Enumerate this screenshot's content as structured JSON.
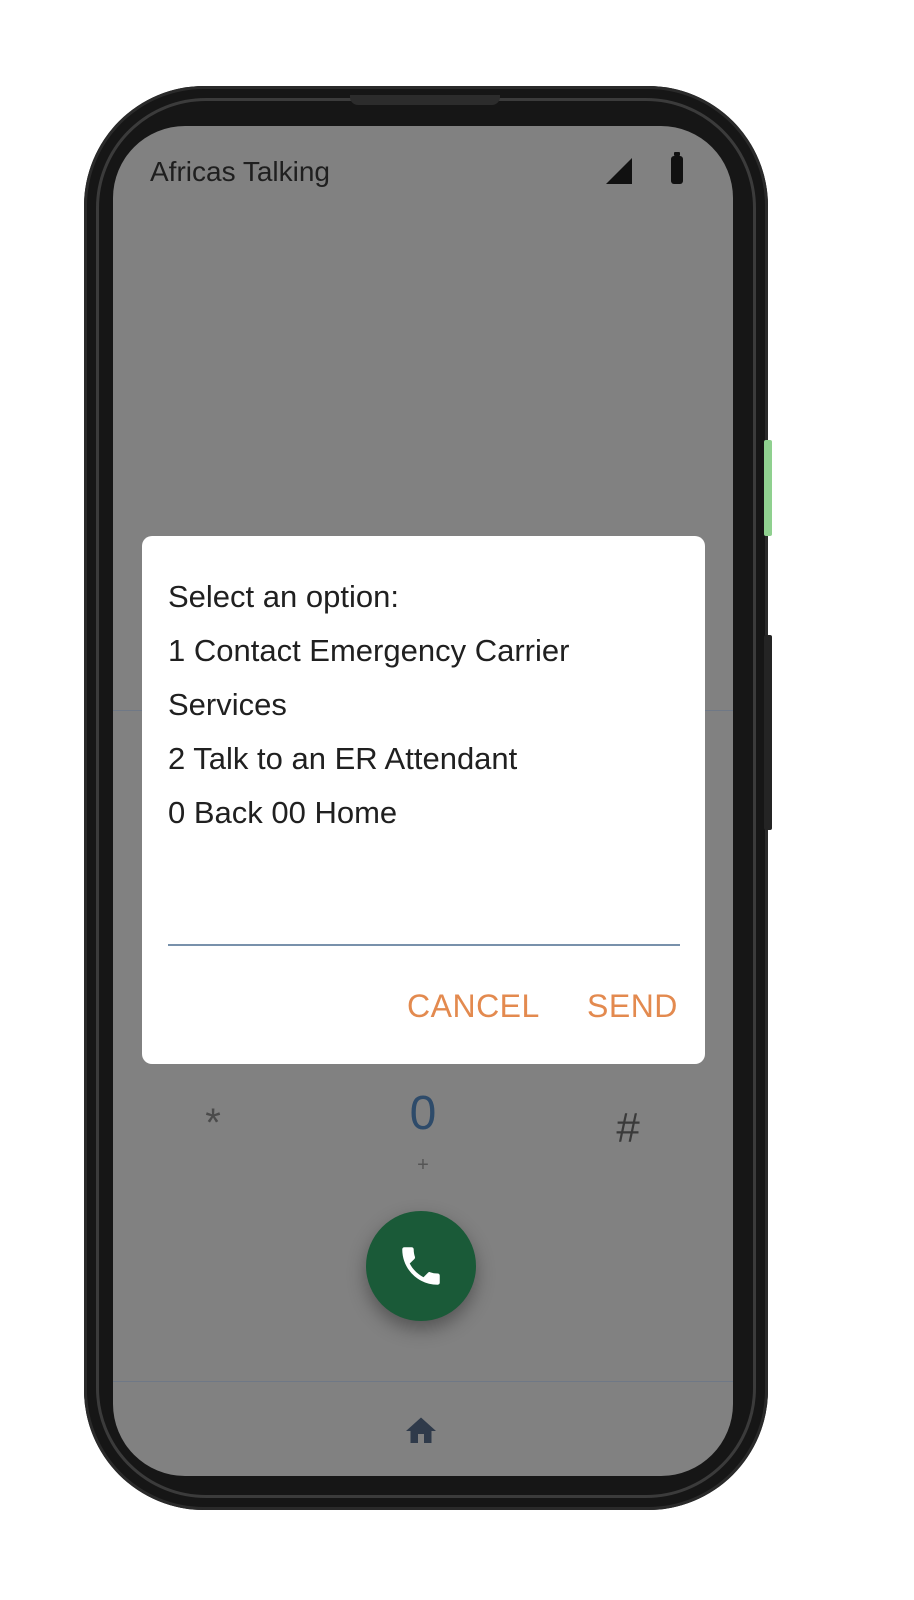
{
  "status_bar": {
    "carrier": "Africas Talking",
    "signal_icon": "signal-icon",
    "battery_icon": "battery-icon"
  },
  "keypad": {
    "star": "*",
    "zero": "0",
    "zero_sub": "+",
    "hash": "#",
    "call_icon": "phone-icon",
    "call_color": "#1a5a38"
  },
  "nav": {
    "home_icon": "home-icon"
  },
  "dialog": {
    "lines": [
      "Select an option:",
      "1 Contact Emergency Carrier Services",
      "2 Talk to an ER Attendant",
      "0 Back 00 Home"
    ],
    "input_value": "",
    "cancel_label": "CANCEL",
    "send_label": "SEND",
    "accent_color": "#e38a4f"
  }
}
